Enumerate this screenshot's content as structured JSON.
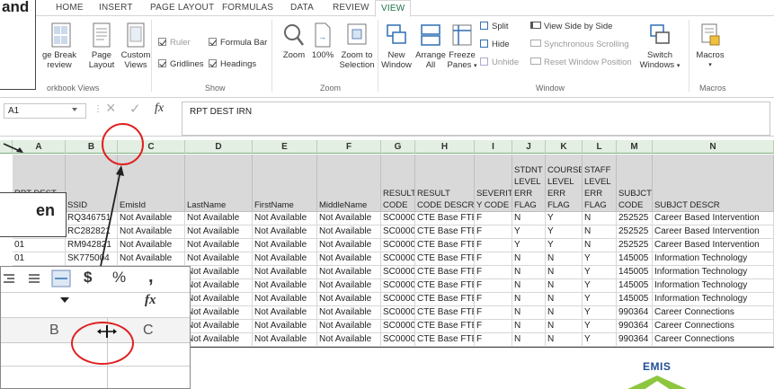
{
  "ribbon": {
    "tabs": [
      "HOME",
      "INSERT",
      "PAGE LAYOUT",
      "FORMULAS",
      "DATA",
      "REVIEW",
      "VIEW"
    ],
    "active_tab": "VIEW",
    "workbook_views": {
      "page_break": [
        "ge Break",
        "review"
      ],
      "page_layout": [
        "Page",
        "Layout"
      ],
      "custom_views": [
        "Custom",
        "Views"
      ],
      "label": "orkbook Views"
    },
    "show": {
      "ruler": "Ruler",
      "formula_bar": "Formula Bar",
      "gridlines": "Gridlines",
      "headings": "Headings",
      "label": "Show"
    },
    "zoom": {
      "zoom": "Zoom",
      "hundred": "100%",
      "zoom_to_selection": [
        "Zoom to",
        "Selection"
      ],
      "label": "Zoom"
    },
    "window": {
      "new_window": [
        "New",
        "Window"
      ],
      "arrange_all": [
        "Arrange",
        "All"
      ],
      "freeze_panes": [
        "Freeze",
        "Panes"
      ],
      "split": "Split",
      "hide": "Hide",
      "unhide": "Unhide",
      "view_side_by_side": "View Side by Side",
      "synchronous_scrolling": "Synchronous Scrolling",
      "reset_window_position": "Reset Window Position",
      "switch_windows": [
        "Switch",
        "Windows"
      ],
      "label": "Window"
    },
    "macros": {
      "macros": "Macros",
      "label": "Macros"
    }
  },
  "formula_bar": {
    "name_box": "A1",
    "fx": "fx",
    "content": "RPT DEST IRN"
  },
  "grid": {
    "columns": [
      "A",
      "B",
      "C",
      "D",
      "E",
      "F",
      "G",
      "H",
      "I",
      "J",
      "K",
      "L",
      "M",
      "N"
    ],
    "row_numbers": [
      "1"
    ],
    "headers": [
      "RPT DEST\nIRN",
      "SSID",
      "EmisId",
      "LastName",
      "FirstName",
      "MiddleName",
      "RESULT\nCODE",
      "RESULT\nCODE DESCR",
      "SEVERIT\nY CODE",
      "STDNT\nLEVEL\nERR\nFLAG",
      "COURSE\nLEVEL\nERR\nFLAG",
      "STAFF\nLEVEL\nERR\nFLAG",
      "SUBJCT\nCODE",
      "SUBJCT DESCR"
    ],
    "rows": [
      [
        "01",
        "RQ346751",
        "Not Available",
        "Not Available",
        "Not Available",
        "Not Available",
        "SC0000",
        "CTE Base FTE",
        "F",
        "N",
        "Y",
        "N",
        "252525",
        "Career Based Intervention"
      ],
      [
        "01",
        "RC282821",
        "Not Available",
        "Not Available",
        "Not Available",
        "Not Available",
        "SC0000",
        "CTE Base FTE",
        "F",
        "Y",
        "Y",
        "N",
        "252525",
        "Career Based Intervention"
      ],
      [
        "01",
        "RM942821",
        "Not Available",
        "Not Available",
        "Not Available",
        "Not Available",
        "SC0000",
        "CTE Base FTE",
        "F",
        "Y",
        "Y",
        "N",
        "252525",
        "Career Based Intervention"
      ],
      [
        "01",
        "SK775004",
        "Not Available",
        "Not Available",
        "Not Available",
        "Not Available",
        "SC0000",
        "CTE Base FTE",
        "F",
        "N",
        "N",
        "Y",
        "145005",
        "Information Technology"
      ],
      [
        "",
        "",
        "ot Available",
        "Not Available",
        "Not Available",
        "Not Available",
        "SC0000",
        "CTE Base FTE",
        "F",
        "N",
        "N",
        "Y",
        "145005",
        "Information Technology"
      ],
      [
        "",
        "",
        "ot Available",
        "Not Available",
        "Not Available",
        "Not Available",
        "SC0000",
        "CTE Base FTE",
        "F",
        "N",
        "N",
        "Y",
        "145005",
        "Information Technology"
      ],
      [
        "",
        "",
        "ot Available",
        "Not Available",
        "Not Available",
        "Not Available",
        "SC0000",
        "CTE Base FTE",
        "F",
        "N",
        "N",
        "Y",
        "145005",
        "Information Technology"
      ],
      [
        "",
        "",
        "ot Available",
        "Not Available",
        "Not Available",
        "Not Available",
        "SC0000",
        "CTE Base FTE",
        "F",
        "N",
        "N",
        "Y",
        "990364",
        "Career Connections"
      ],
      [
        "",
        "",
        "ot Available",
        "Not Available",
        "Not Available",
        "Not Available",
        "SC0000",
        "CTE Base FTE",
        "F",
        "N",
        "N",
        "Y",
        "990364",
        "Career Connections"
      ],
      [
        "",
        "",
        "ot Available",
        "Not Available",
        "Not Available",
        "Not Available",
        "SC0000",
        "CTE Base FTE",
        "F",
        "N",
        "N",
        "Y",
        "990364",
        "Career Connections"
      ]
    ]
  },
  "callouts": {
    "top_left": "and",
    "middle_left": "en"
  },
  "zoom_inset": {
    "currency": "$",
    "percent": "%",
    "comma": ",",
    "fx": "fx",
    "col_b": "B",
    "col_c": "C",
    "cursor": "+"
  },
  "logo": {
    "text": "EMIS"
  },
  "colors": {
    "excel_green": "#217346",
    "highlight_red": "#e02020",
    "header_grey": "#d9d9d9",
    "column_header_green": "#e3efe3",
    "logo_green": "#8dc63f",
    "logo_blue": "#1f4e96"
  }
}
